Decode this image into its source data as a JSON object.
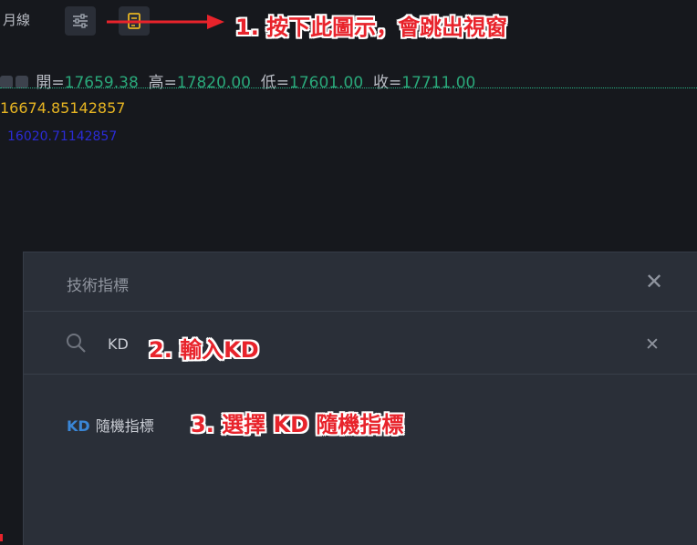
{
  "toolbar": {
    "period_label": "月線",
    "settings_icon": "sliders-icon",
    "indicator_icon": "indicator-doc-icon"
  },
  "annotations": {
    "step1": "1. 按下此圖示，會跳出視窗",
    "step2": "2. 輸入KD",
    "step3": "3. 選擇 KD 隨機指標",
    "color": "#e8232b"
  },
  "ohlc": {
    "open_label": "開=",
    "open": "17659.38",
    "high_label": "高=",
    "high": "17820.00",
    "low_label": "低=",
    "low": "17601.00",
    "close_label": "收=",
    "close": "17711.00"
  },
  "indicator_values": {
    "ma1": "16674.85142857",
    "ma2": "16020.71142857"
  },
  "modal": {
    "title": "技術指標",
    "search_value": "KD",
    "results": [
      {
        "abbr": "KD",
        "name": "隨機指標"
      }
    ]
  },
  "colors": {
    "background": "#16181d",
    "modal": "#2a2f38",
    "up_green": "#2aa87a",
    "ma_yellow": "#e6b422",
    "ma_blue": "#2b2bd6",
    "accent_blue": "#3a86d6"
  }
}
